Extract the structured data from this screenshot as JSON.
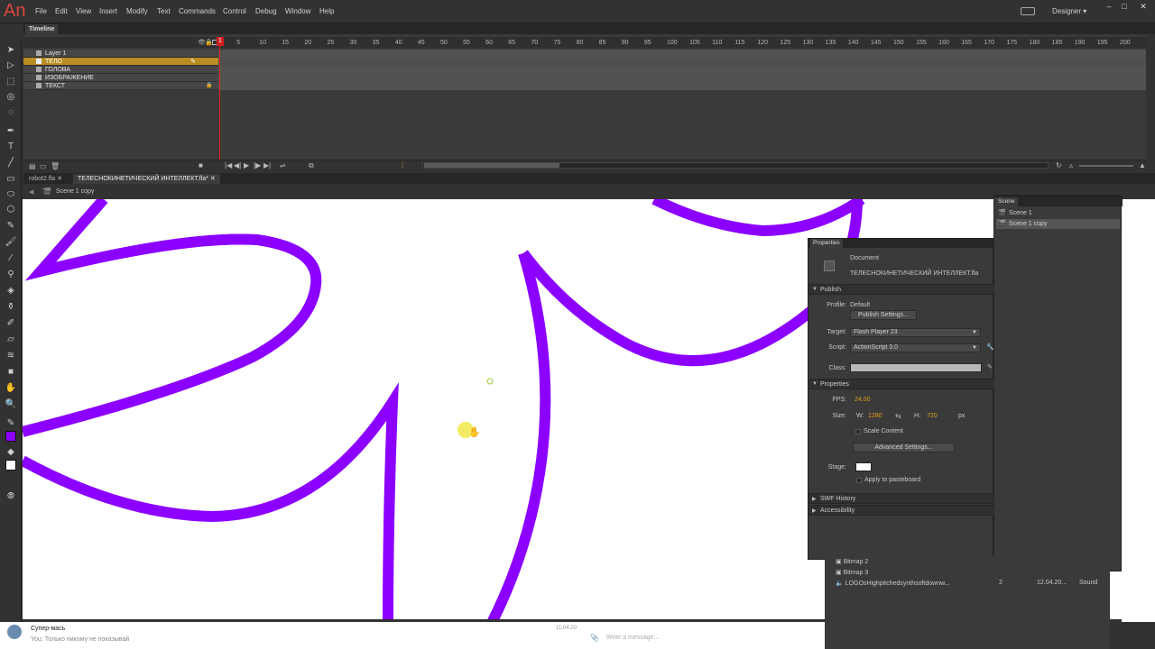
{
  "app": {
    "logo": "An",
    "menu": [
      "File",
      "Edit",
      "View",
      "Insert",
      "Modify",
      "Text",
      "Commands",
      "Control",
      "Debug",
      "Window",
      "Help"
    ],
    "workspace": "Designer ▾",
    "window_controls": [
      "–",
      "□",
      "✕"
    ]
  },
  "timeline": {
    "tab": "Timeline",
    "ticks": [
      "1",
      "5",
      "10",
      "15",
      "20",
      "25",
      "30",
      "35",
      "40",
      "45",
      "50",
      "55",
      "60",
      "65",
      "70",
      "75",
      "80",
      "85",
      "90",
      "95",
      "100",
      "105",
      "110",
      "115",
      "120",
      "125",
      "130",
      "135",
      "140",
      "145",
      "150",
      "155",
      "160",
      "165",
      "170",
      "175",
      "180",
      "185",
      "190",
      "195",
      "200"
    ],
    "layers": [
      {
        "name": "Layer 1",
        "selected": false
      },
      {
        "name": "ТЕЛО",
        "selected": true
      },
      {
        "name": "ГОЛОВА",
        "selected": false
      },
      {
        "name": "ИЗОБРАЖЕНИЕ",
        "selected": false
      },
      {
        "name": "ТЕКСТ",
        "selected": false
      }
    ],
    "playhead_frame": "1"
  },
  "docs": {
    "tabs": [
      "robot2.fla ✕",
      "ТЕЛЕСНОКИНЕТИЧЕСКИЙ ИНТЕЛЛЕКТ.fla* ✕"
    ],
    "scene_crumb": "Scene 1 copy"
  },
  "properties": {
    "tab": "Properties",
    "doc_type": "Document",
    "doc_name": "ТЕЛЕСНОКИНЕТИЧЕСКИЙ ИНТЕЛЛЕКТ.fla",
    "publish_section": "Publish",
    "profile_label": "Profile:",
    "profile_value": "Default",
    "publish_settings_button": "Publish Settings...",
    "target_label": "Target:",
    "target_value": "Flash Player 23",
    "script_label": "Script:",
    "script_value": "ActionScript 3.0",
    "class_label": "Class:",
    "properties_section": "Properties",
    "fps_label": "FPS:",
    "fps_value": "24.00",
    "size_label": "Size:",
    "w_label": "W:",
    "w_value": "1280",
    "h_label": "H:",
    "h_value": "720",
    "unit": "px",
    "scale_content": "Scale Content",
    "advanced_settings_button": "Advanced Settings...",
    "stage_label": "Stage:",
    "stage_color": "#ffffff",
    "apply_pasteboard": "Apply to pasteboard",
    "swf_history": "SWF History",
    "accessibility": "Accessibility"
  },
  "scene_panel": {
    "tab": "Scene",
    "scenes": [
      {
        "name": "Scene 1",
        "selected": false
      },
      {
        "name": "Scene 1 copy",
        "selected": true
      }
    ]
  },
  "library": {
    "rows": [
      {
        "name": "Bitmap 2",
        "col2": "",
        "col3": "",
        "col4": ""
      },
      {
        "name": "Bitmap 3",
        "col2": "",
        "col3": "",
        "col4": ""
      },
      {
        "name": "LOGOsHighpitchedsynthsoftdownw...",
        "col2": "2",
        "col3": "12.04.20...",
        "col4": "Sound"
      }
    ]
  },
  "chat": {
    "name": "Супер-мась",
    "message": "You: Только никому не показывай",
    "time": "11.04.20",
    "input_placeholder": "Write a message..."
  },
  "colors": {
    "stroke": "#8b00ff",
    "accent": "#e0a020",
    "layer_selected": "#b98d22",
    "playhead": "#e02020"
  }
}
